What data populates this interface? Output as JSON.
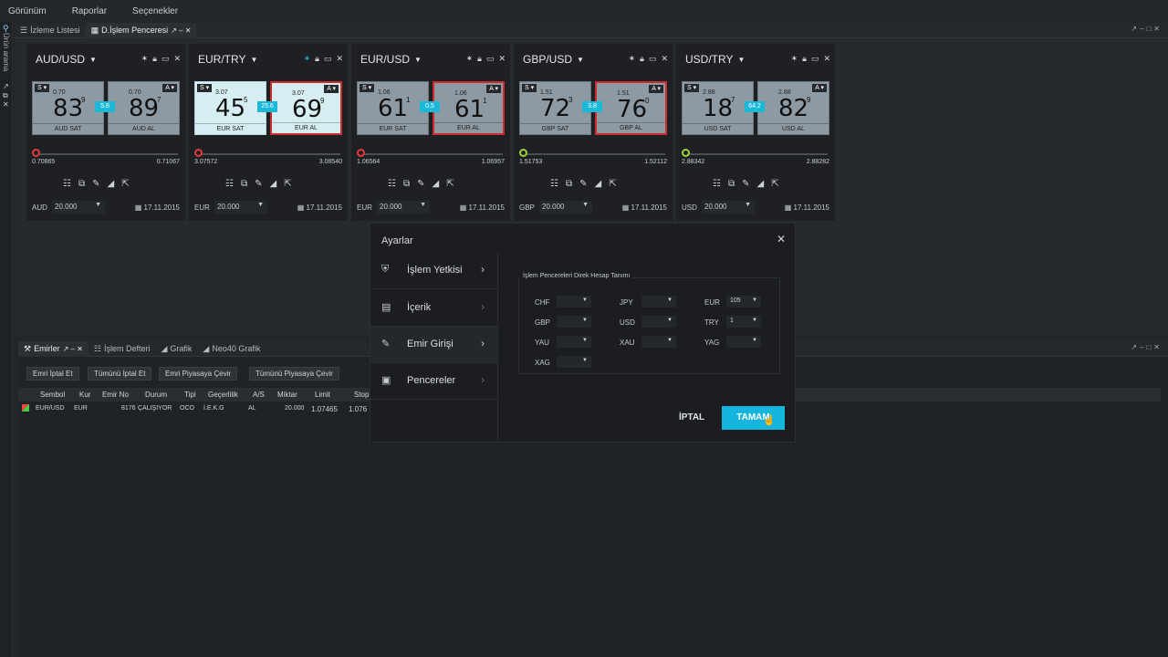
{
  "menu": [
    "Görünüm",
    "Raporlar",
    "Seçenekler"
  ],
  "side_label": "Ürün arama",
  "top_tabs": {
    "watchlist": "İzleme Listesi",
    "trade_windows": "D.İşlem Penceresi"
  },
  "cards": [
    {
      "pair": "AUD/USD",
      "sell_small": "0.70",
      "sell_big": "83",
      "sell_sup": "9",
      "buy_small": "0.70",
      "buy_big": "89",
      "buy_sup": "7",
      "spread": "5.8",
      "sell_label": "AUD SAT",
      "buy_label": "AUD AL",
      "low": "0.70865",
      "high": "0.71067",
      "currency": "AUD",
      "amount": "20.000",
      "date": "17.11.2015",
      "knob": "red",
      "selected": "none",
      "light": false
    },
    {
      "pair": "EUR/TRY",
      "sell_small": "3.07",
      "sell_big": "45",
      "sell_sup": "5",
      "buy_small": "3.07",
      "buy_big": "69",
      "buy_sup": "9",
      "spread": "25.6",
      "sell_label": "EUR SAT",
      "buy_label": "EUR AL",
      "low": "3.07572",
      "high": "3.08540",
      "currency": "EUR",
      "amount": "20.000",
      "date": "17.11.2015",
      "knob": "red",
      "selected": "buy",
      "light": true
    },
    {
      "pair": "EUR/USD",
      "sell_small": "1.06",
      "sell_big": "61",
      "sell_sup": "1",
      "buy_small": "1.06",
      "buy_big": "61",
      "buy_sup": "1",
      "spread": "0.5",
      "sell_label": "EUR SAT",
      "buy_label": "EUR AL",
      "low": "1.06564",
      "high": "1.06957",
      "currency": "EUR",
      "amount": "20.000",
      "date": "17.11.2015",
      "knob": "red",
      "selected": "buy",
      "light": false
    },
    {
      "pair": "GBP/USD",
      "sell_small": "1.51",
      "sell_big": "72",
      "sell_sup": "3",
      "buy_small": "1.51",
      "buy_big": "76",
      "buy_sup": "0",
      "spread": "3.8",
      "sell_label": "GBP SAT",
      "buy_label": "GBP AL",
      "low": "1.51753",
      "high": "1.52112",
      "currency": "GBP",
      "amount": "20.000",
      "date": "17.11.2015",
      "knob": "green",
      "selected": "buy",
      "light": false
    },
    {
      "pair": "USD/TRY",
      "sell_small": "2.88",
      "sell_big": "18",
      "sell_sup": "7",
      "buy_small": "2.88",
      "buy_big": "82",
      "buy_sup": "9",
      "spread": "64.2",
      "sell_label": "USD SAT",
      "buy_label": "USD AL",
      "low": "2.88342",
      "high": "2.88282",
      "currency": "USD",
      "amount": "20.000",
      "date": "17.11.2015",
      "knob": "green",
      "selected": "none",
      "light": false
    }
  ],
  "bottom_tabs": {
    "orders": "Emirler",
    "ledger": "İşlem Defteri",
    "chart": "Grafik",
    "neo": "Neo40 Grafik"
  },
  "actions": [
    "Emri İptal Et",
    "Tümünü İptal Et",
    "Emri Piyasaya Çevir",
    "Tümünü Piyasaya Çevir"
  ],
  "table": {
    "headers": [
      "Sembol",
      "Kur",
      "Emir No",
      "Durum",
      "Tipi",
      "Geçerlilik",
      "A/S",
      "Miktar",
      "Limit",
      "Stop"
    ],
    "row": [
      "EUR/USD",
      "EUR",
      "8176",
      "ÇALIŞIYOR",
      "OCO",
      "İ.E.K.G",
      "AL",
      "20.000",
      "1.07465",
      "1.076"
    ]
  },
  "dialog": {
    "title": "Ayarlar",
    "nav": [
      "İşlem Yetkisi",
      "İçerik",
      "Emir Girişi",
      "Pencereler"
    ],
    "group_title": "İşlem Pencereleri Direk Hesap Tanımı",
    "fields": [
      {
        "label": "CHF",
        "value": ""
      },
      {
        "label": "JPY",
        "value": ""
      },
      {
        "label": "EUR",
        "value": "105"
      },
      {
        "label": "GBP",
        "value": ""
      },
      {
        "label": "USD",
        "value": ""
      },
      {
        "label": "TRY",
        "value": "1"
      },
      {
        "label": "YAU",
        "value": ""
      },
      {
        "label": "XAU",
        "value": ""
      },
      {
        "label": "YAG",
        "value": ""
      },
      {
        "label": "XAG",
        "value": ""
      }
    ],
    "cancel": "İPTAL",
    "ok": "TAMAM"
  }
}
